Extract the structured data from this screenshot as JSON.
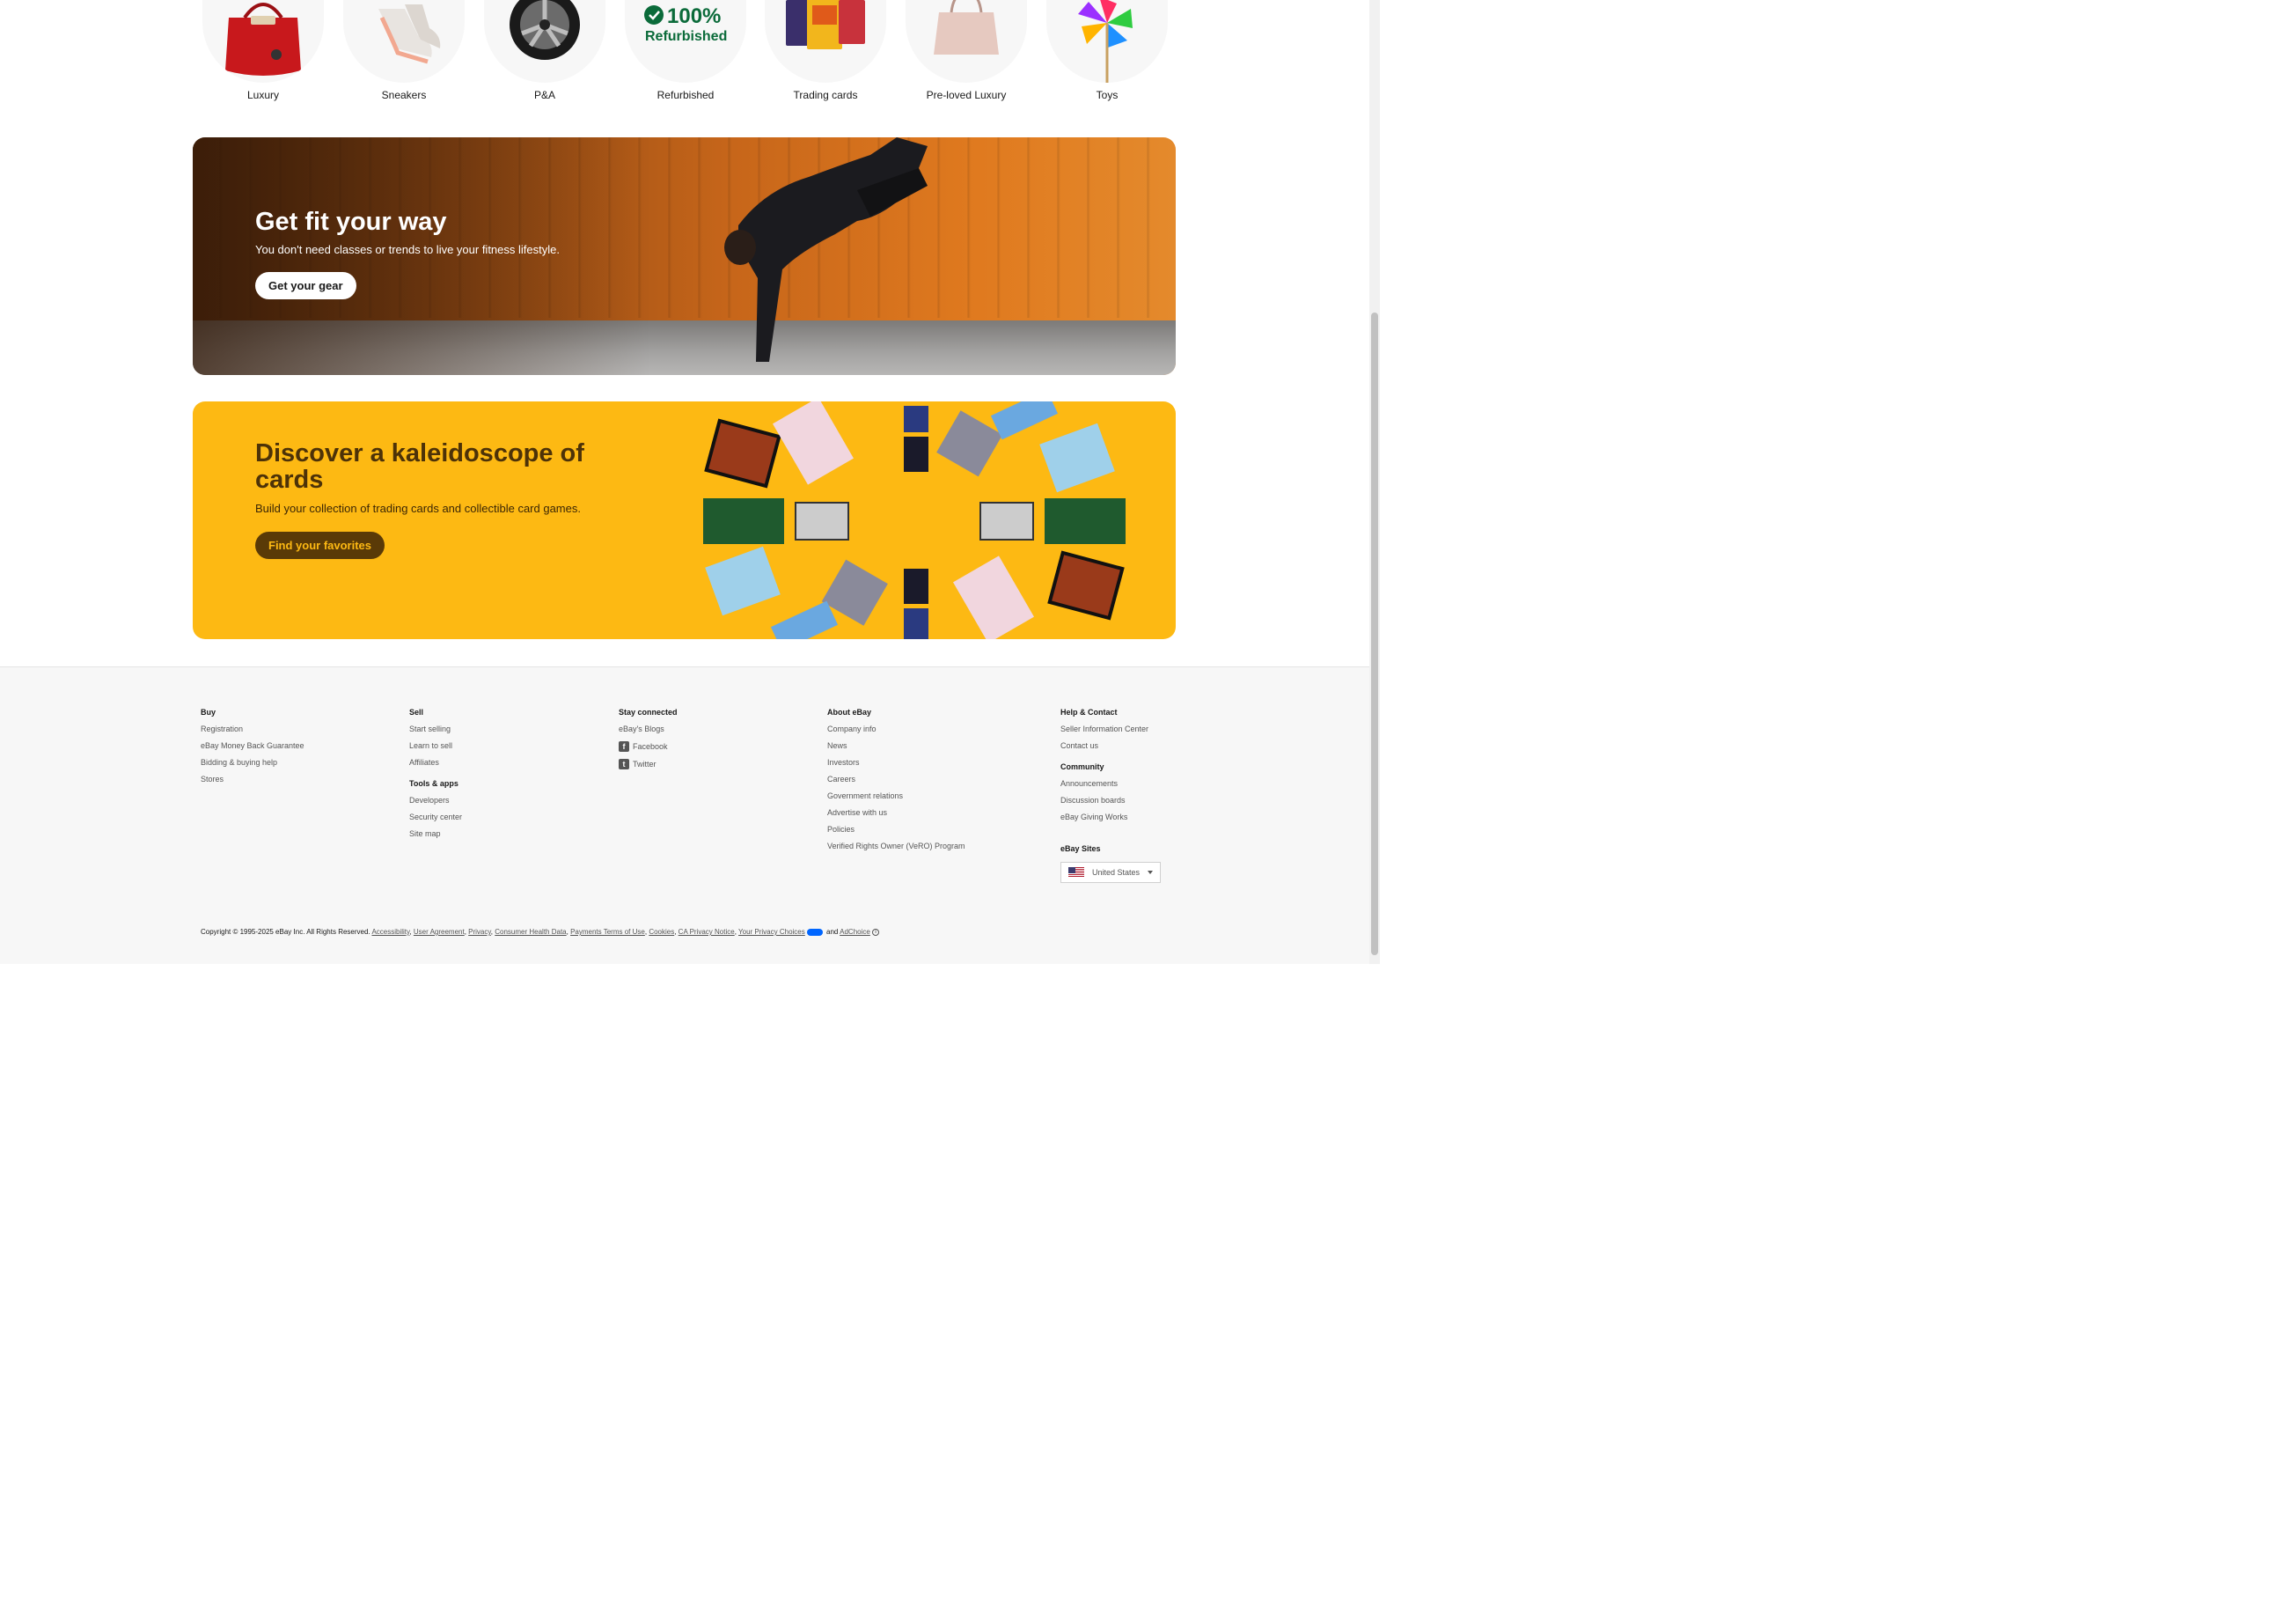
{
  "categories": [
    {
      "label": "Luxury",
      "icon": "handbag-icon"
    },
    {
      "label": "Sneakers",
      "icon": "sneaker-icon"
    },
    {
      "label": "P&A",
      "icon": "wheel-icon"
    },
    {
      "label": "Refurbished",
      "icon": "refurbished-badge-icon",
      "badge_pct": "100%",
      "badge_word": "Refurbished"
    },
    {
      "label": "Trading cards",
      "icon": "trading-cards-icon"
    },
    {
      "label": "Pre-loved Luxury",
      "icon": "tote-bag-icon"
    },
    {
      "label": "Toys",
      "icon": "pinwheel-icon"
    }
  ],
  "banners": {
    "fit": {
      "title": "Get fit your way",
      "subtitle": "You don't need classes or trends to live your fitness lifestyle.",
      "cta": "Get your gear",
      "accent": "#e07a1f"
    },
    "cards": {
      "title": "Discover a kaleidoscope of cards",
      "subtitle": "Build your collection of trading cards and collectible card games.",
      "cta": "Find your favorites",
      "bg": "#fdb913"
    }
  },
  "footer": {
    "buy": {
      "heading": "Buy",
      "links": [
        "Registration",
        "eBay Money Back Guarantee",
        "Bidding & buying help",
        "Stores"
      ]
    },
    "sell": {
      "heading": "Sell",
      "links": [
        "Start selling",
        "Learn to sell",
        "Affiliates"
      ]
    },
    "tools": {
      "heading": "Tools & apps",
      "links": [
        "Developers",
        "Security center",
        "Site map"
      ]
    },
    "stay": {
      "heading": "Stay connected",
      "blog": "eBay's Blogs",
      "facebook": "Facebook",
      "twitter": "Twitter"
    },
    "about": {
      "heading": "About eBay",
      "links": [
        "Company info",
        "News",
        "Investors",
        "Careers",
        "Government relations",
        "Advertise with us",
        "Policies",
        "Verified Rights Owner (VeRO) Program"
      ]
    },
    "help": {
      "heading": "Help & Contact",
      "links": [
        "Seller Information Center",
        "Contact us"
      ]
    },
    "community": {
      "heading": "Community",
      "links": [
        "Announcements",
        "Discussion boards",
        "eBay Giving Works"
      ]
    },
    "sites": {
      "heading": "eBay Sites",
      "selected": "United States"
    },
    "legal": {
      "copyright": "Copyright © 1995-2025 eBay Inc. All Rights Reserved.",
      "links": [
        "Accessibility",
        "User Agreement",
        "Privacy",
        "Consumer Health Data",
        "Payments Terms of Use",
        "Cookies",
        "CA Privacy Notice",
        "Your Privacy Choices"
      ],
      "and": "and",
      "adchoice": "AdChoice"
    }
  }
}
